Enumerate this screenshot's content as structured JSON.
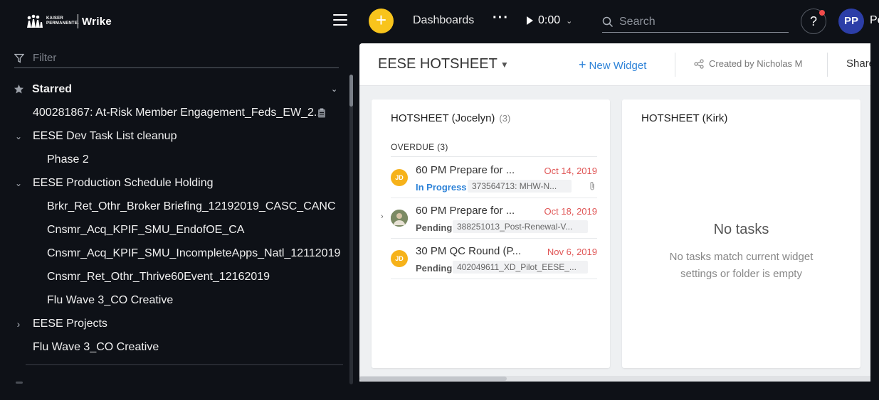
{
  "app": {
    "brand_small": "KAISER PERMANENTE.",
    "brand_name": "Wrike",
    "nav_dashboards": "Dashboards",
    "more_label": "···",
    "timer_value": "0:00",
    "search_placeholder": "Search",
    "help_label": "?",
    "user_initials": "PP",
    "user_name_cut": "Pe"
  },
  "sidebar": {
    "filter_placeholder": "Filter",
    "starred_label": "Starred",
    "items": [
      {
        "label": "400281867: At-Risk Member Engagement_Feds_EW_2..."
      },
      {
        "label": "EESE Dev Task List cleanup"
      },
      {
        "label": "Phase 2"
      },
      {
        "label": "EESE Production Schedule Holding"
      },
      {
        "label": "Brkr_Ret_Othr_Broker Briefing_12192019_CASC_CANC"
      },
      {
        "label": "Cnsmr_Acq_KPIF_SMU_EndofOE_CA"
      },
      {
        "label": "Cnsmr_Acq_KPIF_SMU_IncompleteApps_Natl_12112019"
      },
      {
        "label": "Cnsmr_Ret_Othr_Thrive60Event_12162019"
      },
      {
        "label": "Flu Wave 3_CO Creative"
      },
      {
        "label": "EESE Projects"
      },
      {
        "label": "Flu Wave 3_CO Creative"
      }
    ]
  },
  "dashboard": {
    "title": "EESE HOTSHEET",
    "new_widget_label": "New Widget",
    "created_by": "Created by Nicholas M",
    "share_label": "Share",
    "widgets": [
      {
        "title": "HOTSHEET (Jocelyn)",
        "count": "(3)",
        "section": "OVERDUE (3)",
        "tasks": [
          {
            "name": "60 PM Prepare for ...",
            "date": "Oct 14, 2019",
            "status": "In Progress",
            "folder": "373564713: MHW-N...",
            "initials": "JD"
          },
          {
            "name": "60 PM Prepare for ...",
            "date": "Oct 18, 2019",
            "status": "Pending",
            "folder": "388251013_Post-Renewal-V...",
            "initials": ""
          },
          {
            "name": "30 PM QC Round (P...",
            "date": "Nov 6, 2019",
            "status": "Pending",
            "folder": "402049611_XD_Pilot_EESE_...",
            "initials": "JD"
          }
        ]
      },
      {
        "title": "HOTSHEET (Kirk)",
        "empty_title": "No tasks",
        "empty_sub": "No tasks match current widget settings or folder is empty"
      }
    ]
  },
  "colors": {
    "accent_yellow": "#f8c41c",
    "link_blue": "#2e83d8",
    "overdue_red": "#e05656",
    "avatar_blue": "#2c3ea8",
    "notification_red": "#f24b4b"
  },
  "icons": [
    "hamburger-icon",
    "plus-icon",
    "play-icon",
    "chevron-down-icon",
    "search-icon",
    "help-icon",
    "filter-icon",
    "star-icon",
    "clipboard-icon",
    "share-icon",
    "paperclip-icon"
  ]
}
